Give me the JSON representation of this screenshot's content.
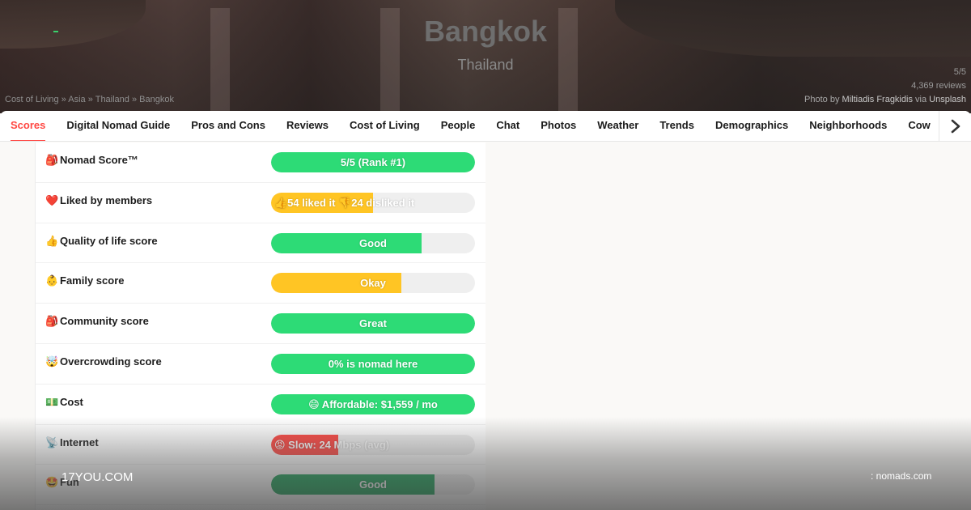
{
  "hero": {
    "city": "Bangkok",
    "country": "Thailand",
    "breadcrumb": [
      "Cost of Living",
      "Asia",
      "Thailand",
      "Bangkok"
    ],
    "breadcrumb_sep": " » ",
    "score": "5/5",
    "reviews": "4,369 reviews",
    "photo_by": "Photo by",
    "photographer": "Miltiadis Fragkidis",
    "via": "via",
    "source": "Unsplash"
  },
  "tabs": [
    {
      "label": "Scores",
      "active": true
    },
    {
      "label": "Digital Nomad Guide"
    },
    {
      "label": "Pros and Cons"
    },
    {
      "label": "Reviews"
    },
    {
      "label": "Cost of Living"
    },
    {
      "label": "People"
    },
    {
      "label": "Chat"
    },
    {
      "label": "Photos"
    },
    {
      "label": "Weather"
    },
    {
      "label": "Trends"
    },
    {
      "label": "Demographics"
    },
    {
      "label": "Neighborhoods"
    },
    {
      "label": "Cow"
    }
  ],
  "tab_next_icon": "chevron-right-icon",
  "scores": [
    {
      "emoji": "🎒",
      "label": "Nomad Score™",
      "bar_text": "5/5 (Rank #1)",
      "fill": 1.0,
      "color": "#2ddb76"
    },
    {
      "emoji": "❤️",
      "label": "Liked by members",
      "bar_text": "👍54 liked it 👎24 disliked it",
      "fill": 0.5,
      "color": "#ffc524"
    },
    {
      "emoji": "👍",
      "label": "Quality of life score",
      "bar_text": "Good",
      "fill": 0.74,
      "color": "#2ddb76"
    },
    {
      "emoji": "👶",
      "label": "Family score",
      "bar_text": "Okay",
      "fill": 0.64,
      "color": "#ffc524"
    },
    {
      "emoji": "🎒",
      "label": "Community score",
      "bar_text": "Great",
      "fill": 1.0,
      "color": "#2ddb76"
    },
    {
      "emoji": "🤯",
      "label": "Overcrowding score",
      "bar_text": "0% is nomad here",
      "fill": 1.0,
      "color": "#2ddb76"
    },
    {
      "emoji": "💵",
      "label": "Cost",
      "bar_text": "😄 Affordable: $1,559 / mo",
      "fill": 1.0,
      "color": "#2ddb76"
    },
    {
      "emoji": "📡",
      "label": "Internet",
      "bar_text": "😡 Slow: 24 Mbps (avg)",
      "fill": 0.33,
      "color": "#ff4742"
    },
    {
      "emoji": "🤩",
      "label": "Fun",
      "bar_text": "Good",
      "fill": 0.8,
      "color": "#1ea35a"
    }
  ],
  "watermark": {
    "left": "17YOU.COM",
    "right": ": nomads.com"
  }
}
